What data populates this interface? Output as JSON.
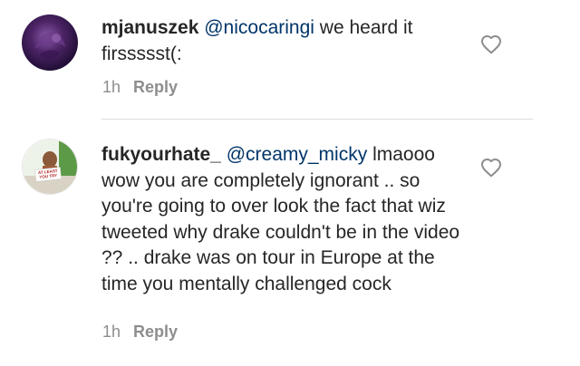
{
  "comments": [
    {
      "username": "mjanuszek",
      "mention": "@nicocaringi",
      "text": " we heard it firssssst(:",
      "time": "1h",
      "reply_label": "Reply"
    },
    {
      "username": "fukyourhate_",
      "mention": "@creamy_micky",
      "text": " lmaooo wow you are completely ignorant .. so you're going to over look the fact that wiz tweeted why drake couldn't be in the video ?? .. drake was on tour in Europe at the time you mentally challenged cock",
      "time": "1h",
      "reply_label": "Reply",
      "avatar_sign_text": "AT LEAST YOU TRY"
    }
  ],
  "icons": {
    "like": "heart-outline-icon"
  },
  "colors": {
    "text": "#262626",
    "mention": "#003569",
    "meta": "#8e8e8e",
    "divider": "#dbdbdb"
  }
}
